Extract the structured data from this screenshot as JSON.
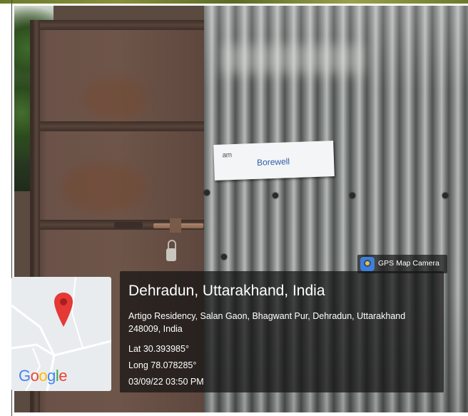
{
  "sign": {
    "logo_text": "am",
    "label": "Borewell"
  },
  "gps_label": {
    "app_name": "GPS Map Camera",
    "icon": "gps-map-camera-icon"
  },
  "map_card": {
    "brand": "Google",
    "pin_icon": "map-pin-icon",
    "pin_color": "#e53935"
  },
  "location": {
    "place": "Dehradun, Uttarakhand, India",
    "address_line1": "Artigo Residency, Salan Gaon, Bhagwant Pur, Dehradun, Uttarakhand",
    "address_line2": "248009, India",
    "lat": "Lat 30.393985°",
    "long": "Long 78.078285°",
    "datetime": "03/09/22 03:50 PM"
  }
}
